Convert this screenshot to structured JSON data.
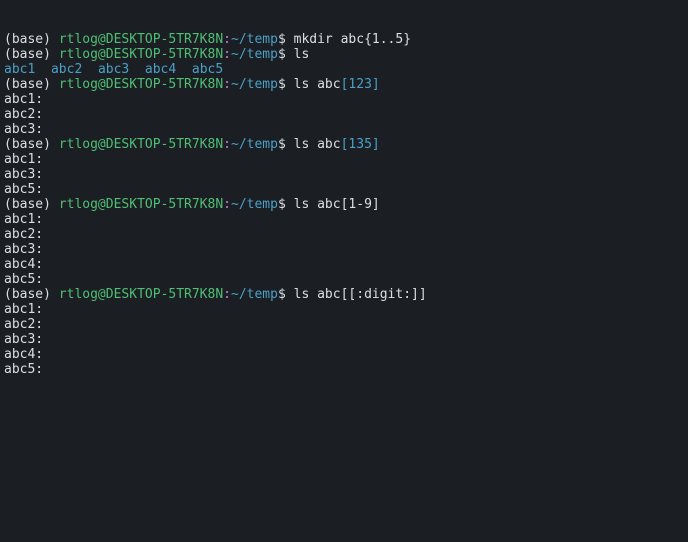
{
  "lines": [
    {
      "type": "prompt",
      "base": "(base) ",
      "user": "rtlog@DESKTOP-5TR7K8N",
      "colon": ":",
      "path": "~/temp",
      "dollar": "$ ",
      "cmd": "mkdir abc{1..5}",
      "arg": ""
    },
    {
      "type": "prompt",
      "base": "(base) ",
      "user": "rtlog@DESKTOP-5TR7K8N",
      "colon": ":",
      "path": "~/temp",
      "dollar": "$ ",
      "cmd": "ls",
      "arg": ""
    },
    {
      "type": "dirs",
      "items": [
        "abc1",
        "abc2",
        "abc3",
        "abc4",
        "abc5"
      ]
    },
    {
      "type": "prompt",
      "base": "(base) ",
      "user": "rtlog@DESKTOP-5TR7K8N",
      "colon": ":",
      "path": "~/temp",
      "dollar": "$ ",
      "cmd": "ls abc",
      "arg": "[123]"
    },
    {
      "type": "out",
      "text": "abc1:"
    },
    {
      "type": "out",
      "text": ""
    },
    {
      "type": "out",
      "text": "abc2:"
    },
    {
      "type": "out",
      "text": ""
    },
    {
      "type": "out",
      "text": "abc3:"
    },
    {
      "type": "prompt",
      "base": "(base) ",
      "user": "rtlog@DESKTOP-5TR7K8N",
      "colon": ":",
      "path": "~/temp",
      "dollar": "$ ",
      "cmd": "ls abc",
      "arg": "[135]"
    },
    {
      "type": "out",
      "text": "abc1:"
    },
    {
      "type": "out",
      "text": ""
    },
    {
      "type": "out",
      "text": "abc3:"
    },
    {
      "type": "out",
      "text": ""
    },
    {
      "type": "out",
      "text": "abc5:"
    },
    {
      "type": "prompt",
      "base": "(base) ",
      "user": "rtlog@DESKTOP-5TR7K8N",
      "colon": ":",
      "path": "~/temp",
      "dollar": "$ ",
      "cmd": "ls abc[1-9]",
      "arg": ""
    },
    {
      "type": "out",
      "text": "abc1:"
    },
    {
      "type": "out",
      "text": ""
    },
    {
      "type": "out",
      "text": "abc2:"
    },
    {
      "type": "out",
      "text": ""
    },
    {
      "type": "out",
      "text": "abc3:"
    },
    {
      "type": "out",
      "text": ""
    },
    {
      "type": "out",
      "text": "abc4:"
    },
    {
      "type": "out",
      "text": ""
    },
    {
      "type": "out",
      "text": "abc5:"
    },
    {
      "type": "prompt",
      "base": "(base) ",
      "user": "rtlog@DESKTOP-5TR7K8N",
      "colon": ":",
      "path": "~/temp",
      "dollar": "$ ",
      "cmd": "ls abc[[:digit:]]",
      "arg": ""
    },
    {
      "type": "out",
      "text": "abc1:"
    },
    {
      "type": "out",
      "text": ""
    },
    {
      "type": "out",
      "text": "abc2:"
    },
    {
      "type": "out",
      "text": ""
    },
    {
      "type": "out",
      "text": "abc3:"
    },
    {
      "type": "out",
      "text": ""
    },
    {
      "type": "out",
      "text": "abc4:"
    },
    {
      "type": "out",
      "text": ""
    },
    {
      "type": "out",
      "text": "abc5:"
    }
  ]
}
